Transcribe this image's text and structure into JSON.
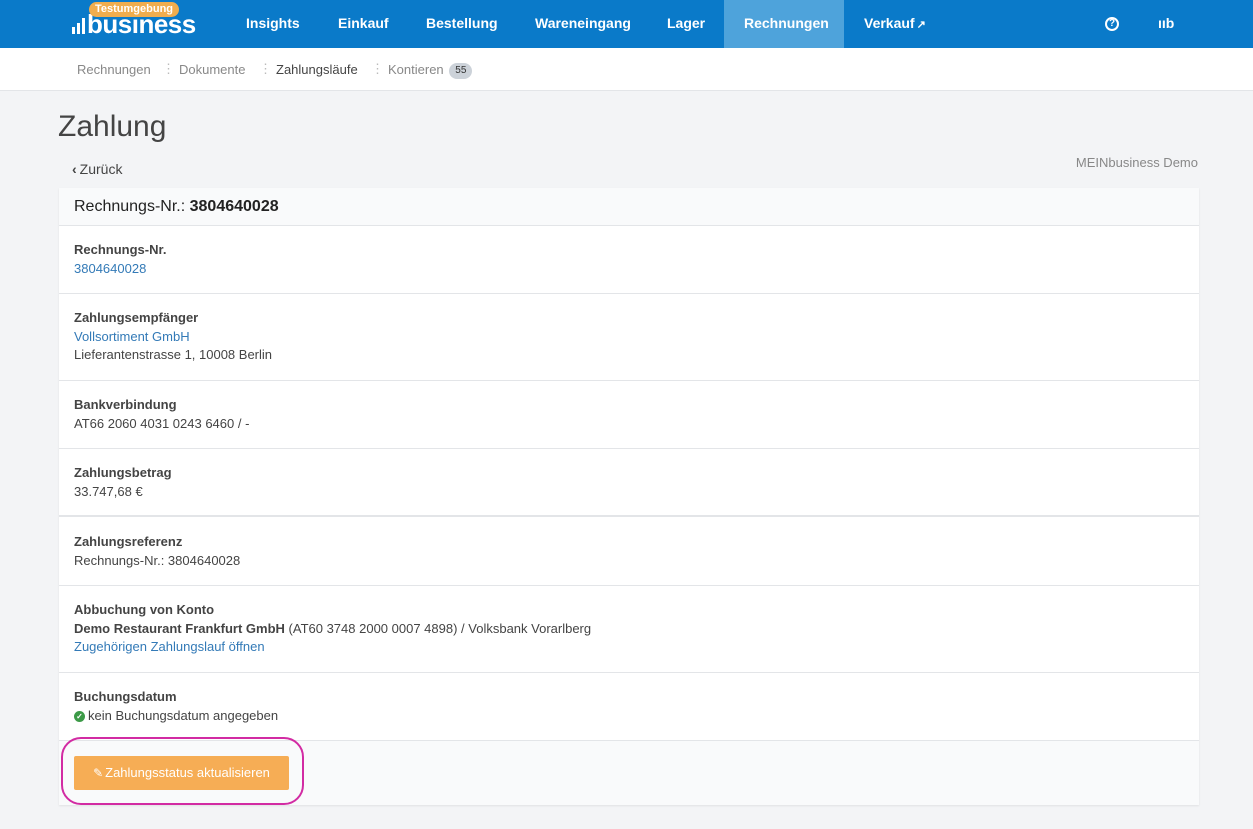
{
  "app": {
    "logo_text": "business",
    "env_badge": "Testumgebung"
  },
  "nav": {
    "items": [
      "Insights",
      "Einkauf",
      "Bestellung",
      "Wareneingang",
      "Lager",
      "Rechnungen",
      "Verkauf"
    ],
    "active": "Rechnungen",
    "external_icon": "external-link-icon",
    "help_icon": "?",
    "user_menu": "ııb"
  },
  "subnav": {
    "items": [
      "Rechnungen",
      "Dokumente",
      "Zahlungsläufe",
      "Kontieren"
    ],
    "active": "Zahlungsläufe",
    "kontieren_badge": "55",
    "separator": "⋮"
  },
  "page": {
    "title": "Zahlung",
    "back_label": "Zurück",
    "company": "MEINbusiness Demo"
  },
  "card": {
    "title_prefix": "Rechnungs-Nr.:",
    "title_number": "3804640028",
    "invoice": {
      "label": "Rechnungs-Nr.",
      "value": "3804640028"
    },
    "recipient": {
      "label": "Zahlungsempfänger",
      "name": "Vollsortiment GmbH",
      "address": "Lieferantenstrasse 1, 10008 Berlin"
    },
    "bank": {
      "label": "Bankverbindung",
      "value": "AT66 2060 4031 0243 6460 / -"
    },
    "amount": {
      "label": "Zahlungsbetrag",
      "value": "33.747,68 €"
    },
    "reference": {
      "label": "Zahlungsreferenz",
      "value": "Rechnungs-Nr.: 3804640028"
    },
    "debit": {
      "label": "Abbuchung von Konto",
      "account_name": "Demo Restaurant Frankfurt GmbH",
      "account_details": " (AT60 3748 2000 0007 4898) / Volksbank Vorarlberg",
      "link": "Zugehörigen Zahlungslauf öffnen"
    },
    "booking": {
      "label": "Buchungsdatum",
      "value": "kein Buchungsdatum angegeben"
    },
    "update_button": "Zahlungsstatus aktualisieren"
  }
}
